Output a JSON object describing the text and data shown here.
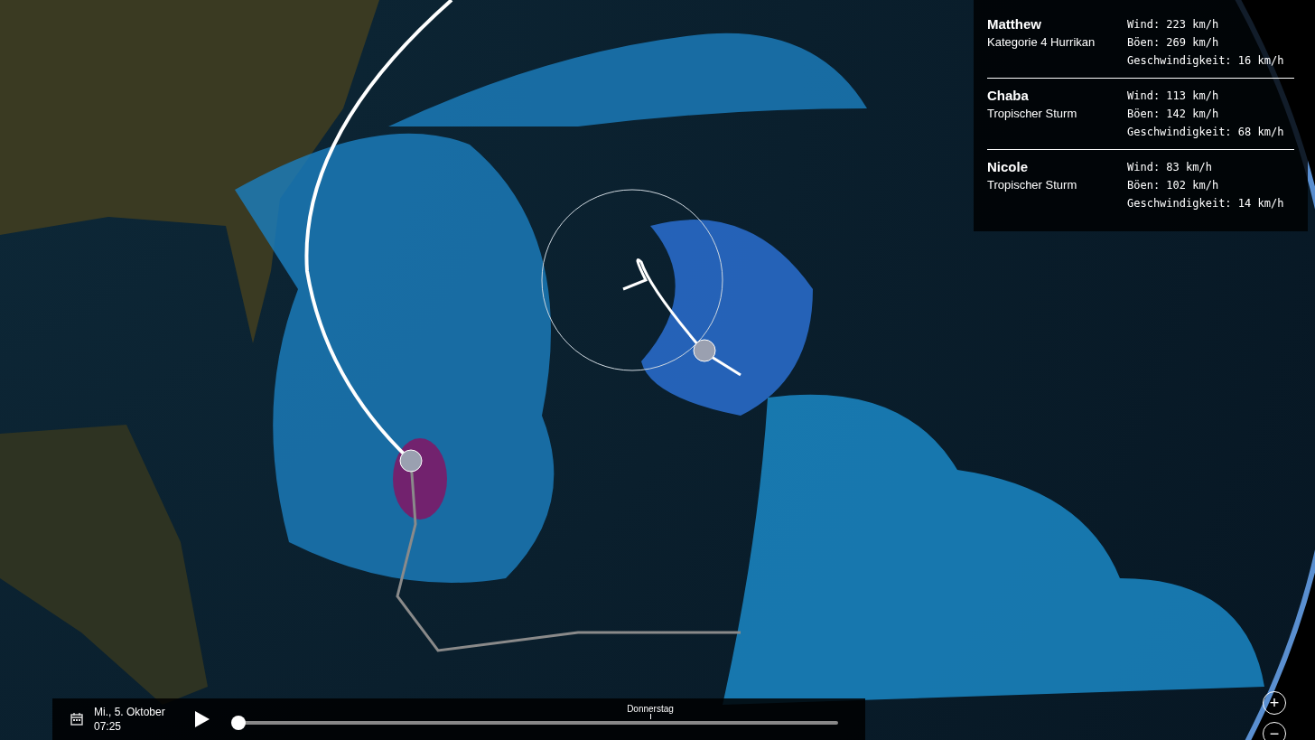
{
  "storms": [
    {
      "name": "Matthew",
      "category": "Kategorie 4 Hurrikan",
      "stats": [
        "Wind: 223 km/h",
        "Böen: 269 km/h",
        "Geschwindigkeit: 16 km/h"
      ]
    },
    {
      "name": "Chaba",
      "category": "Tropischer Sturm",
      "stats": [
        "Wind: 113 km/h",
        "Böen: 142 km/h",
        "Geschwindigkeit: 68 km/h"
      ]
    },
    {
      "name": "Nicole",
      "category": "Tropischer Sturm",
      "stats": [
        "Wind: 83 km/h",
        "Böen: 102 km/h",
        "Geschwindigkeit: 14 km/h"
      ]
    }
  ],
  "timeline": {
    "date": "Mi., 5. Oktober",
    "time": "07:25",
    "level": 0,
    "marker": {
      "label": "Donnerstag"
    }
  },
  "zoom": {
    "in": "+",
    "out": "−"
  }
}
